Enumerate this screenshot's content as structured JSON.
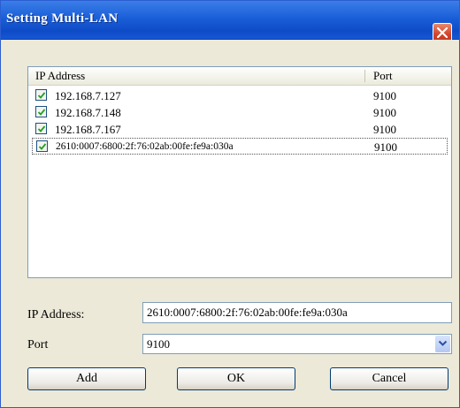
{
  "window": {
    "title": "Setting Multi-LAN"
  },
  "list": {
    "headers": {
      "ip": "IP Address",
      "port": "Port"
    },
    "rows": [
      {
        "ip": "192.168.7.127",
        "port": "9100",
        "checked": true
      },
      {
        "ip": "192.168.7.148",
        "port": "9100",
        "checked": true
      },
      {
        "ip": "192.168.7.167",
        "port": "9100",
        "checked": true
      },
      {
        "ip": "2610:0007:6800:2f:76:02ab:00fe:fe9a:030a",
        "port": "9100",
        "checked": true
      }
    ]
  },
  "form": {
    "ip_label": "IP Address:",
    "ip_value": "2610:0007:6800:2f:76:02ab:00fe:fe9a:030a",
    "port_label": "Port",
    "port_value": "9100"
  },
  "buttons": {
    "add": "Add",
    "ok": "OK",
    "cancel": "Cancel"
  },
  "colors": {
    "titlebar": "#1a5fd8",
    "close_button": "#d2442a",
    "dialog_bg": "#ece9d8",
    "checkmark": "#21a121"
  },
  "icons": {
    "close": "close-icon",
    "check": "checkmark-icon",
    "dropdown": "chevron-down-icon"
  }
}
